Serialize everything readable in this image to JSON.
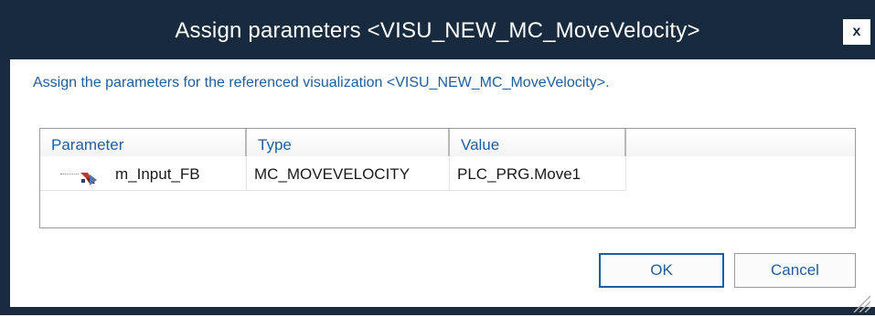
{
  "window": {
    "title": "Assign parameters <VISU_NEW_MC_MoveVelocity>",
    "close_label": "x"
  },
  "instruction": "Assign the parameters for the referenced visualization <VISU_NEW_MC_MoveVelocity>.",
  "grid": {
    "columns": [
      "Parameter",
      "Type",
      "Value",
      ""
    ],
    "rows": [
      {
        "parameter": "m_Input_FB",
        "type": "MC_MOVEVELOCITY",
        "value": "PLC_PRG.Move1",
        "icon": "function-block-icon"
      }
    ]
  },
  "buttons": {
    "ok_label": "OK",
    "cancel_label": "Cancel"
  },
  "colors": {
    "titlebar": "#182a3e",
    "accent_text": "#1f5e9e"
  }
}
